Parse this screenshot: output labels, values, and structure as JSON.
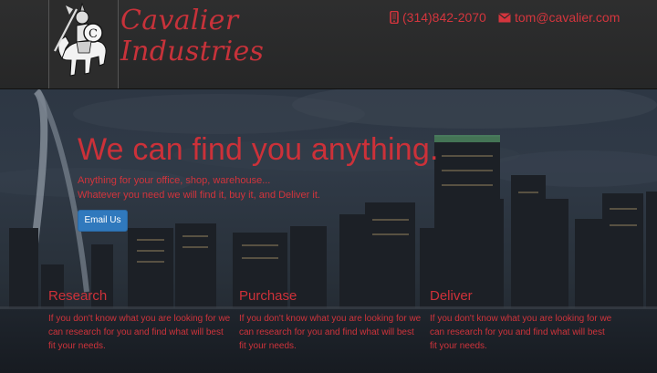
{
  "brand": {
    "line1": "Cavalier",
    "line2": "Industries",
    "logo_icon": "knight-on-horse-logo"
  },
  "contact": {
    "phone": "(314)842-2070",
    "email": "tom@cavalier.com",
    "phone_icon": "phone-icon",
    "email_icon": "envelope-icon"
  },
  "hero": {
    "headline": "We can find you anything.",
    "tagline_1": "Anything for your office, shop, warehouse...",
    "tagline_2": "Whatever you need we will find it, buy it, and Deliver it.",
    "cta_label": "Email Us"
  },
  "features": [
    {
      "title": "Research",
      "text": "If you don't know what you are looking for we can research for you and find what will best fit your needs."
    },
    {
      "title": "Purchase",
      "text": "If you don't know what you are looking for we can research for you and find what will best fit your needs."
    },
    {
      "title": "Deliver",
      "text": "If you don't know what you are looking for we can research for you and find what will best fit your needs."
    }
  ],
  "colors": {
    "accent": "#cc3139",
    "button": "#3079bd",
    "header": "#2b2b2b"
  }
}
